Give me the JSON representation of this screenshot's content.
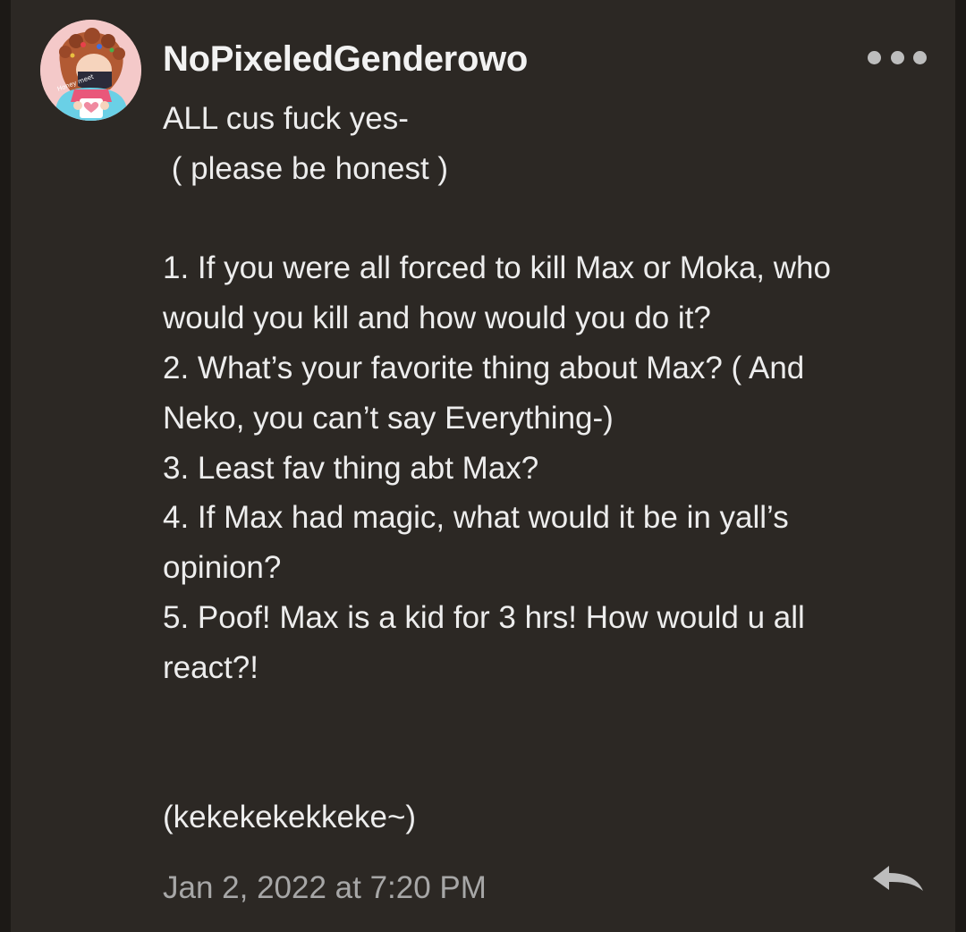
{
  "post": {
    "username": "NoPixeledGenderowo",
    "timestamp": "Jan 2, 2022 at 7:20 PM",
    "avatar_text": "Honey meet",
    "lines": [
      "ALL cus fuck yes-",
      " ( please be honest )",
      "",
      "1. If you were all forced to kill Max or Moka, who",
      "would you kill and how would you do it?",
      "2. What’s your favorite thing about Max? ( And",
      "Neko, you can’t say Everything-)",
      "3. Least fav thing abt Max?",
      "4. If Max had magic, what would it be in yall’s",
      "opinion?",
      "5. Poof! Max is a kid for 3 hrs! How would u all",
      "react?!",
      "",
      "",
      "(kekekekekkeke~)"
    ]
  },
  "icons": {
    "more": "more-options-icon",
    "reply": "reply-icon"
  },
  "colors": {
    "background": "#2c2824",
    "username": "#f2f2f2",
    "text": "#ededed",
    "timestamp": "#a7a7a7",
    "icon": "#bdbdbd"
  }
}
